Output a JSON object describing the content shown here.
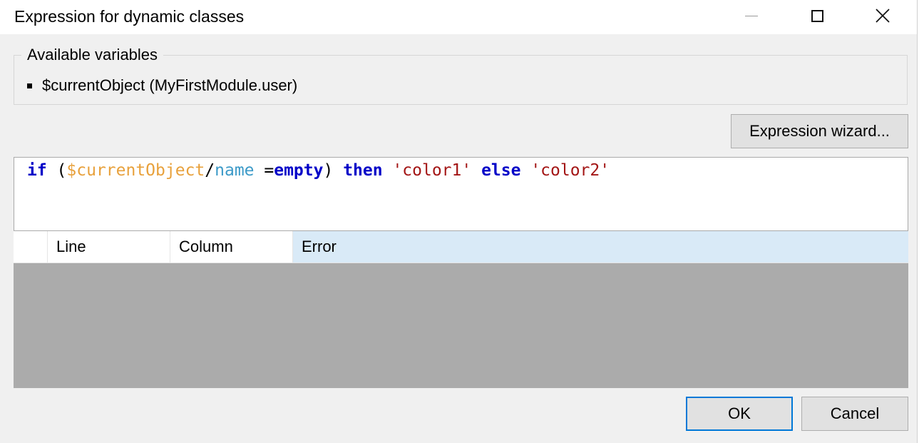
{
  "window": {
    "title": "Expression for dynamic classes"
  },
  "variables": {
    "legend": "Available variables",
    "items": [
      "$currentObject (MyFirstModule.user)"
    ]
  },
  "toolbar": {
    "wizard_label": "Expression wizard..."
  },
  "editor": {
    "tokens": {
      "if": "if",
      "open": " (",
      "var": "$currentObject",
      "slash": "/",
      "attr": "name",
      "eq": " =",
      "empty": "empty",
      "close": ")",
      "then": " then",
      "s1": " 'color1'",
      "else": " else",
      "s2": " 'color2'"
    }
  },
  "errors": {
    "columns": [
      "Line",
      "Column",
      "Error"
    ],
    "rows": []
  },
  "footer": {
    "ok_label": "OK",
    "cancel_label": "Cancel"
  },
  "colors": {
    "accent": "#0078d7",
    "keyword": "#0000c8",
    "variable": "#e8a13c",
    "attribute": "#3c9ac8",
    "string": "#a31515",
    "error_header": "#d9eaf7",
    "error_area": "#ababab"
  },
  "icons": [
    "minimize-icon",
    "maximize-icon",
    "close-icon"
  ]
}
